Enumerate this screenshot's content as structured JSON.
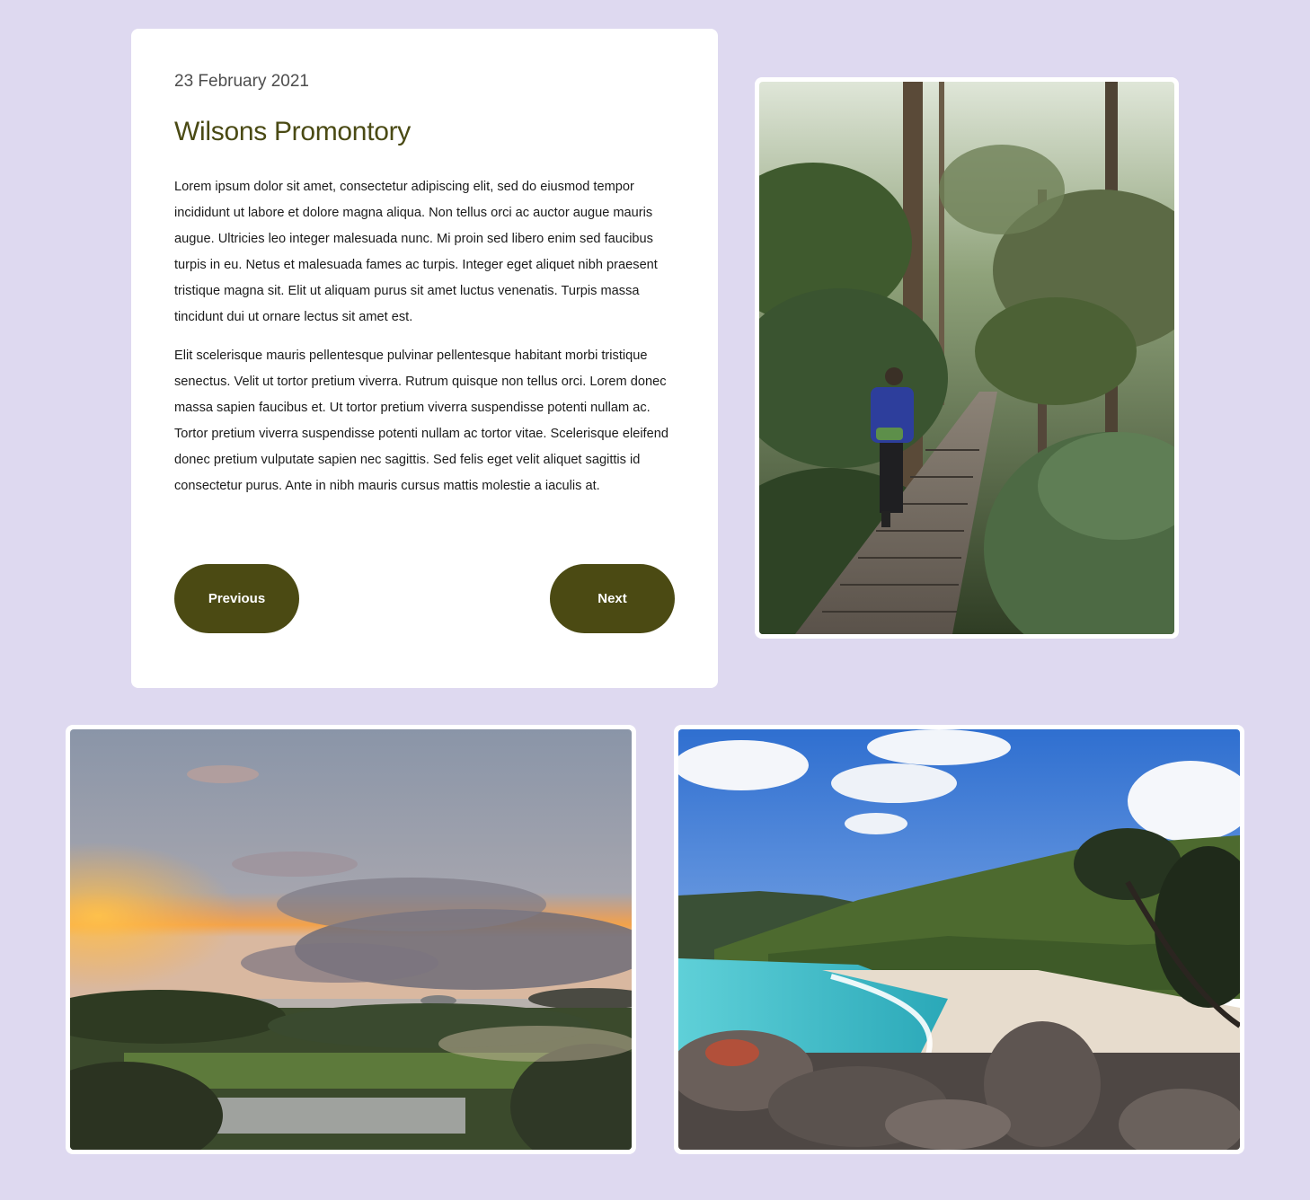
{
  "post": {
    "date": "23 February 2021",
    "title": "Wilsons Promontory",
    "paragraphs": [
      "Lorem ipsum dolor sit amet, consectetur adipiscing elit, sed do eiusmod tempor incididunt ut labore et dolore magna aliqua. Non tellus orci ac auctor augue mauris augue. Ultricies leo integer malesuada nunc. Mi proin sed libero enim sed faucibus turpis in eu. Netus et malesuada fames ac turpis. Integer eget aliquet nibh praesent tristique magna sit. Elit ut aliquam purus sit amet luctus venenatis. Turpis massa tincidunt dui ut ornare lectus sit amet est.",
      "Elit scelerisque mauris pellentesque pulvinar pellentesque habitant morbi tristique senectus. Velit ut tortor pretium viverra. Rutrum quisque non tellus orci. Lorem donec massa sapien faucibus et. Ut tortor pretium viverra suspendisse potenti nullam ac. Tortor pretium viverra suspendisse potenti nullam ac tortor vitae. Scelerisque eleifend donec pretium vulputate sapien nec sagittis. Sed felis eget velit aliquet sagittis id consectetur purus. Ante in nibh mauris cursus mattis molestie a iaculis at."
    ]
  },
  "nav": {
    "previous_label": "Previous",
    "next_label": "Next"
  },
  "colors": {
    "background": "#ded9f0",
    "card": "#ffffff",
    "title": "#4a4a14",
    "button": "#4b4a13"
  }
}
